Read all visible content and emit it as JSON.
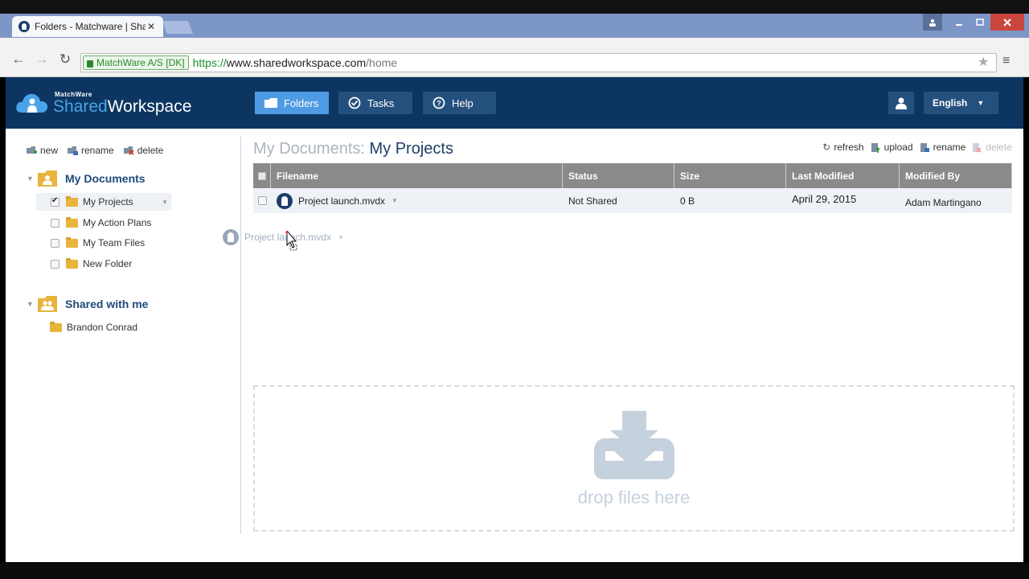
{
  "browser": {
    "tab_title": "Folders - Matchware | Sha",
    "ev_cert": "MatchWare A/S [DK]",
    "url_scheme": "https://",
    "url_host": "www.sharedworkspace.com",
    "url_path": "/home"
  },
  "app": {
    "logo_top": "MatchWare",
    "logo_shared": "Shared",
    "logo_workspace": "Workspace",
    "nav": [
      {
        "label": "Folders",
        "icon": "folder-icon"
      },
      {
        "label": "Tasks",
        "icon": "check-circle-icon"
      },
      {
        "label": "Help",
        "icon": "question-icon"
      }
    ],
    "language": "English"
  },
  "sidebar": {
    "actions": {
      "new": "new",
      "rename": "rename",
      "delete": "delete"
    },
    "my_documents": "My Documents",
    "folders": [
      {
        "label": "My Projects",
        "checked": true
      },
      {
        "label": "My Action Plans",
        "checked": false
      },
      {
        "label": "My Team Files",
        "checked": false
      },
      {
        "label": "New Folder",
        "checked": false
      }
    ],
    "shared_with_me": "Shared with me",
    "shared_folders": [
      {
        "label": "Brandon Conrad"
      }
    ]
  },
  "main": {
    "breadcrumb_parent": "My Documents:",
    "breadcrumb_current": "My Projects",
    "actions": {
      "refresh": "refresh",
      "upload": "upload",
      "rename": "rename",
      "delete": "delete"
    },
    "columns": [
      "Filename",
      "Status",
      "Size",
      "Last Modified",
      "Modified By"
    ],
    "rows": [
      {
        "filename": "Project launch.mvdx",
        "status": "Not Shared",
        "size": "0 B",
        "last_modified": "April 29, 2015",
        "modified_by": "Adam Martingano"
      }
    ],
    "drag_ghost": "Project launch.mvdx",
    "dropzone_text": "drop files here"
  },
  "colors": {
    "header_bg": "#0c3661",
    "active_nav": "#4f9be3",
    "nav_bg": "#24507e",
    "grid_header": "#8a8a8a"
  }
}
